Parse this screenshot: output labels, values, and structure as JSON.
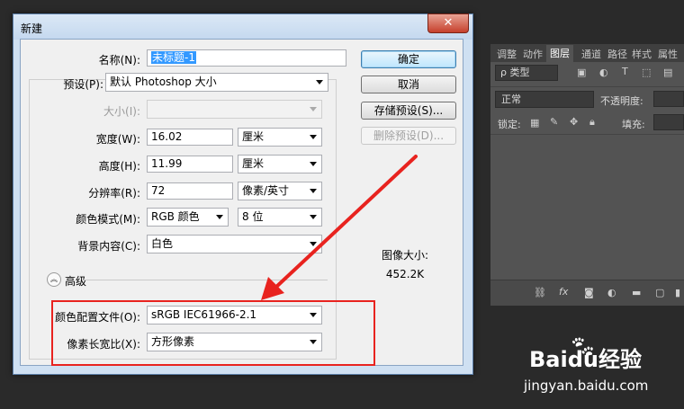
{
  "dialog": {
    "title": "新建",
    "close_glyph": "✕",
    "name_label": "名称(N):",
    "name_value": "未标题-1",
    "preset_label": "预设(P):",
    "preset_value": "默认 Photoshop 大小",
    "size_label": "大小(I):",
    "size_value": "",
    "width_label": "宽度(W):",
    "width_value": "16.02",
    "width_unit": "厘米",
    "height_label": "高度(H):",
    "height_value": "11.99",
    "height_unit": "厘米",
    "resolution_label": "分辨率(R):",
    "resolution_value": "72",
    "resolution_unit": "像素/英寸",
    "colormode_label": "颜色模式(M):",
    "colormode_value": "RGB 颜色",
    "bitdepth_value": "8 位",
    "background_label": "背景内容(C):",
    "background_value": "白色",
    "advanced_label": "高级",
    "advanced_glyph": "︽",
    "profile_label": "颜色配置文件(O):",
    "profile_value": "sRGB IEC61966-2.1",
    "pixel_aspect_label": "像素长宽比(X):",
    "pixel_aspect_value": "方形像素",
    "image_size_label": "图像大小:",
    "image_size_value": "452.2K",
    "buttons": {
      "ok": "确定",
      "cancel": "取消",
      "save_preset": "存储预设(S)...",
      "delete_preset": "删除预设(D)..."
    }
  },
  "annotation": {
    "arrow_color": "#e8231f",
    "box_color": "#e8231f"
  },
  "photoshop_panel": {
    "tabs": [
      "调整",
      "动作",
      "图层",
      "通道",
      "路径",
      "样式",
      "属性"
    ],
    "active_tab": "图层",
    "filter_label": "ρ 类型",
    "blend_mode": "正常",
    "opacity_label": "不透明度:",
    "lock_label": "锁定:",
    "fill_label": "填充:"
  },
  "watermark": {
    "brand": "Baidu经验",
    "url": "jingyan.baidu.com"
  }
}
